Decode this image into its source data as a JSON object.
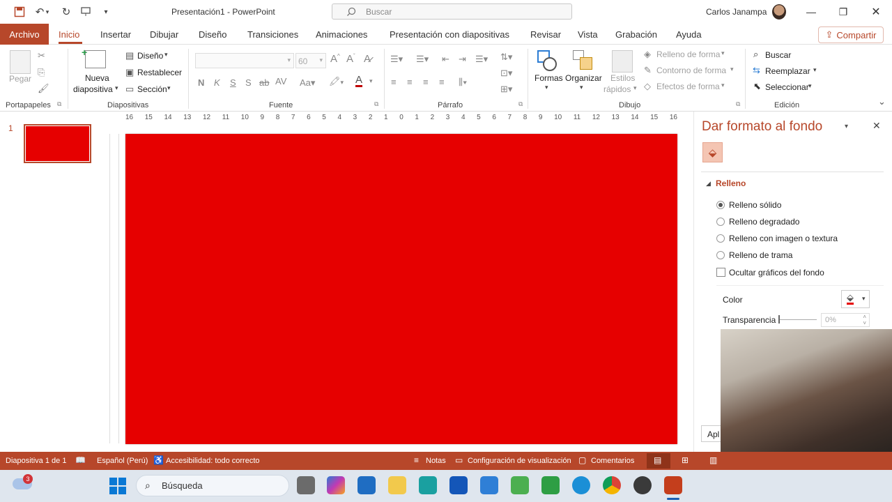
{
  "app": {
    "doc_title": "Presentación1  -  PowerPoint",
    "search_placeholder": "Buscar",
    "user": "Carlos Janampa"
  },
  "tabs": [
    "Archivo",
    "Inicio",
    "Insertar",
    "Dibujar",
    "Diseño",
    "Transiciones",
    "Animaciones",
    "Presentación con diapositivas",
    "Revisar",
    "Vista",
    "Grabación",
    "Ayuda"
  ],
  "share_label": "Compartir",
  "ribbon": {
    "portapapeles": {
      "paste": "Pegar",
      "group": "Portapapeles"
    },
    "diapositivas": {
      "new_slide_1": "Nueva",
      "new_slide_2": "diapositiva",
      "layout": "Diseño",
      "reset": "Restablecer",
      "section": "Sección",
      "group": "Diapositivas"
    },
    "fuente": {
      "size": "60",
      "bold": "N",
      "italic": "K",
      "underline": "S",
      "shadow": "S",
      "strike": "ab",
      "group": "Fuente"
    },
    "parrafo": {
      "group": "Párrafo"
    },
    "dibujo": {
      "shapes": "Formas",
      "arrange": "Organizar",
      "styles_1": "Estilos",
      "styles_2": "rápidos",
      "fill": "Relleno de forma",
      "outline": "Contorno de forma",
      "effects": "Efectos de forma",
      "group": "Dibujo"
    },
    "edicion": {
      "find": "Buscar",
      "replace": "Reemplazar",
      "select": "Seleccionar",
      "group": "Edición"
    }
  },
  "thumbnail": {
    "number": "1",
    "color": "#e60000"
  },
  "ruler": {
    "h_ticks": [
      "16",
      "15",
      "14",
      "13",
      "12",
      "11",
      "10",
      "9",
      "8",
      "7",
      "6",
      "5",
      "4",
      "3",
      "2",
      "1",
      "0",
      "1",
      "2",
      "3",
      "4",
      "5",
      "6",
      "7",
      "8",
      "9",
      "10",
      "11",
      "12",
      "13",
      "14",
      "15",
      "16"
    ]
  },
  "slide": {
    "background": "#e60000"
  },
  "format_pane": {
    "title": "Dar formato al fondo",
    "section": "Relleno",
    "options": [
      "Relleno sólido",
      "Relleno degradado",
      "Relleno con imagen o textura",
      "Relleno de trama"
    ],
    "selected_option": "Relleno sólido",
    "hide_graphics": "Ocultar gráficos del fondo",
    "color_label": "Color",
    "transparency_label": "Transparencia",
    "transparency_value": "0%",
    "apply_btn": "Apl"
  },
  "status": {
    "slide_count": "Diapositiva 1 de 1",
    "language": "Español (Perú)",
    "accessibility": "Accesibilidad: todo correcto",
    "notes": "Notas",
    "display_settings": "Configuración de visualización",
    "comments": "Comentarios"
  },
  "taskbar": {
    "search": "Búsqueda",
    "weather_badge": "3"
  },
  "colors": {
    "accent": "#b7472a",
    "slide_red": "#e60000"
  }
}
